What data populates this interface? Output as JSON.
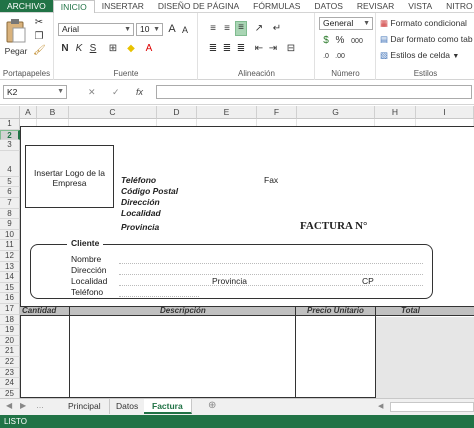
{
  "tabs": [
    "ARCHIVO",
    "INICIO",
    "INSERTAR",
    "DISEÑO DE PÁGINA",
    "FÓRMULAS",
    "DATOS",
    "REVISAR",
    "VISTA",
    "NITRO"
  ],
  "active_tab": "INICIO",
  "ribbon": {
    "clipboard": {
      "paste_label": "Pegar",
      "group_label": "Portapapeles"
    },
    "font": {
      "font_name": "Arial",
      "font_size": "10",
      "group_label": "Fuente",
      "bold": "N",
      "italic": "K",
      "underline": "S",
      "grow": "A",
      "shrink": "A"
    },
    "alignment": {
      "group_label": "Alineación"
    },
    "number": {
      "format": "General",
      "group_label": "Número",
      "percent": "%",
      "thousands": "000"
    },
    "styles": {
      "conditional": "Formato condicional",
      "as_table": "Dar formato como tab",
      "cell_styles": "Estilos de celda",
      "group_label": "Estilos"
    }
  },
  "formula_bar": {
    "name_box": "K2",
    "cancel": "✕",
    "enter": "✓",
    "fx": "fx",
    "value": ""
  },
  "columns": [
    "A",
    "B",
    "C",
    "D",
    "E",
    "F",
    "G",
    "H",
    "I"
  ],
  "rows": [
    "1",
    "2",
    "3",
    "4",
    "5",
    "6",
    "7",
    "8",
    "9",
    "10",
    "11",
    "12",
    "13",
    "14",
    "15",
    "16",
    "17",
    "18",
    "19",
    "20",
    "21",
    "22",
    "23",
    "24",
    "25",
    "26"
  ],
  "selected_row": "2",
  "invoice": {
    "logo_placeholder": "Insertar Logo de la Empresa",
    "company_fields": [
      "Teléfono",
      "Código Postal",
      "Dirección",
      "Localidad",
      "Provincia"
    ],
    "fax_label": "Fax",
    "invoice_title": "FACTURA N°",
    "client_section_title": "Cliente",
    "client_fields": [
      "Nombre",
      "Dirección",
      "Localidad",
      "Teléfono"
    ],
    "province_label": "Provincia",
    "cp_label": "CP",
    "table_headers": [
      "Cantidad",
      "Descripción",
      "Precio Unitario",
      "Total"
    ]
  },
  "sheets": [
    "Principal",
    "Datos",
    "Factura"
  ],
  "active_sheet": "Factura",
  "status": "LISTO"
}
